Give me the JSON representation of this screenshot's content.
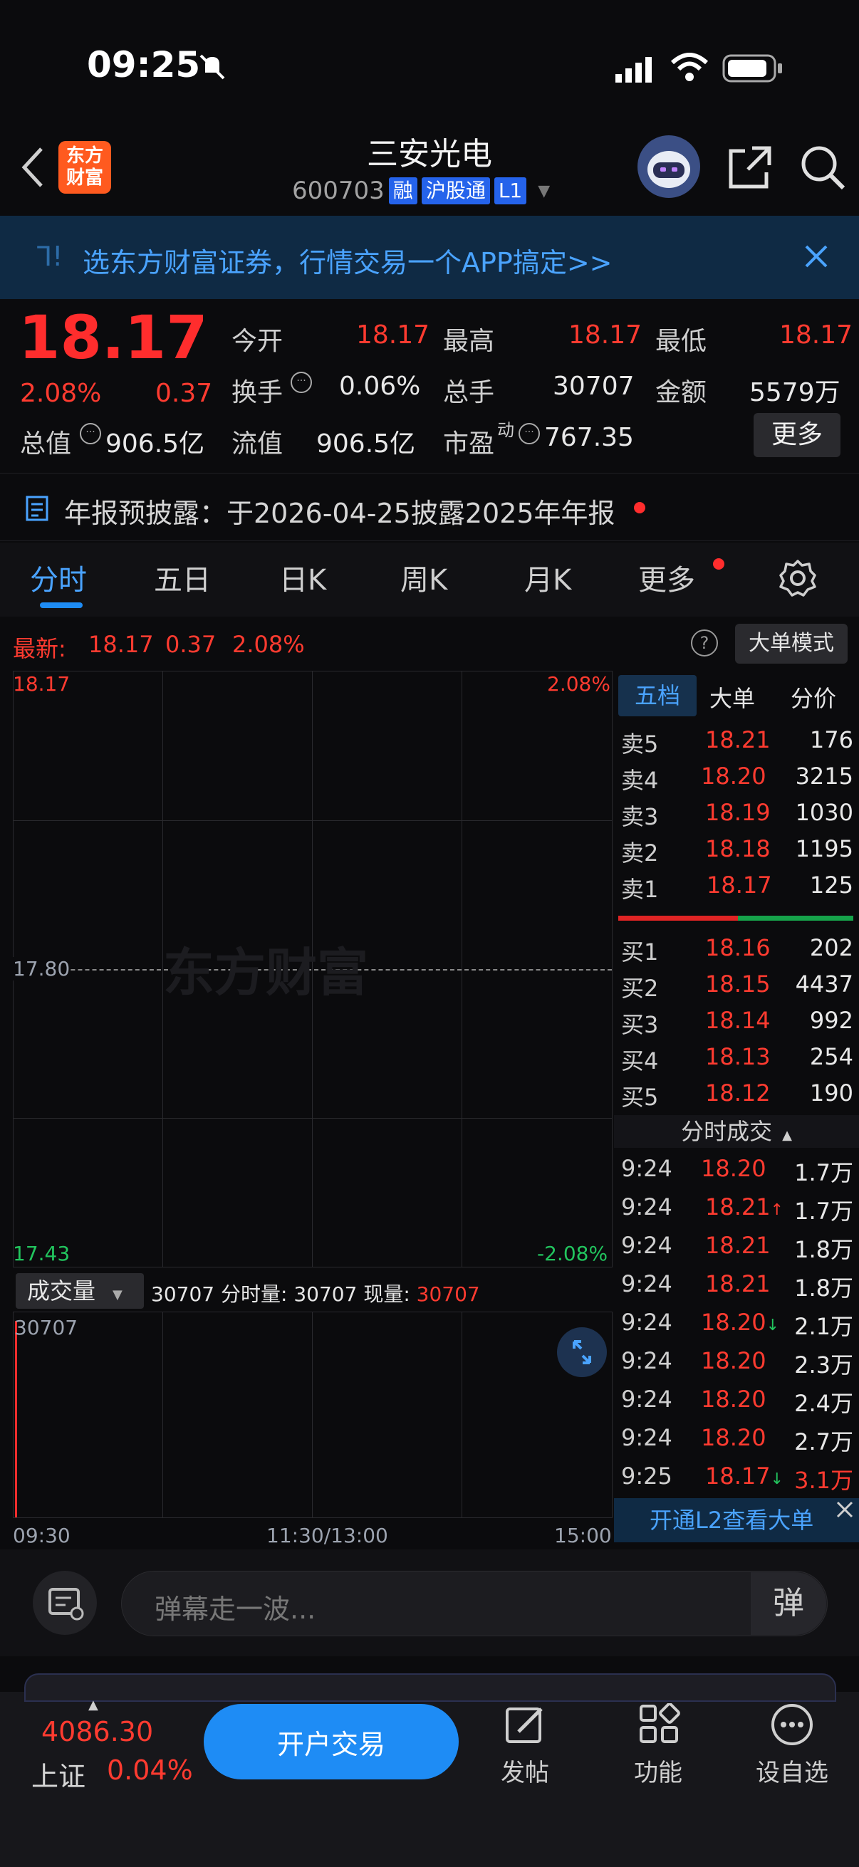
{
  "status_bar": {
    "time": "09:25"
  },
  "header": {
    "title": "三安光电",
    "code": "600703",
    "tag_rong": "融",
    "tag_hgt": "沪股通",
    "tag_l1": "L1",
    "logo_text_1": "东方",
    "logo_text_2": "财富"
  },
  "banner": {
    "text": "选东方财富证券，行情交易一个APP搞定>>"
  },
  "quote": {
    "price": "18.17",
    "change_pct": "2.08%",
    "change": "0.37",
    "open_label": "今开",
    "open": "18.17",
    "high_label": "最高",
    "high": "18.17",
    "low_label": "最低",
    "low": "18.17",
    "turnover_label": "换手",
    "turnover": "0.06%",
    "volume_label": "总手",
    "volume": "30707",
    "amount_label": "金额",
    "amount": "5579万",
    "mktcap_label": "总值",
    "mktcap": "906.5亿",
    "float_label": "流值",
    "float_cap": "906.5亿",
    "pe_label": "市盈",
    "pe_sup": "动",
    "pe": "767.35",
    "more_button": "更多"
  },
  "notice": {
    "text": "年报预披露：于2026-04-25披露2025年年报"
  },
  "tabs": [
    "分时",
    "五日",
    "日K",
    "周K",
    "月K",
    "更多"
  ],
  "latest": {
    "label": "最新:",
    "price": "18.17",
    "change": "0.37",
    "pct": "2.08%",
    "mode_button": "大单模式"
  },
  "chart": {
    "top_price": "18.17",
    "top_pct": "2.08%",
    "mid_price": "17.80",
    "bottom_price": "17.43",
    "bottom_pct": "-2.08%",
    "watermark": "东方财富",
    "volume_dropdown": "成交量",
    "volume_info_total": "30707",
    "volume_info_fen_label": "分时量:",
    "volume_info_fen": "30707",
    "volume_info_now_label": "现量:",
    "volume_info_now": "30707",
    "volume_axis_max": "30707",
    "time_start": "09:30",
    "time_mid": "11:30/13:00",
    "time_end": "15:00"
  },
  "orderbook": {
    "tabs": [
      "五档",
      "大单",
      "分价"
    ],
    "sell": [
      {
        "label": "卖5",
        "price": "18.21",
        "vol": "176"
      },
      {
        "label": "卖4",
        "price": "18.20",
        "vol": "3215"
      },
      {
        "label": "卖3",
        "price": "18.19",
        "vol": "1030"
      },
      {
        "label": "卖2",
        "price": "18.18",
        "vol": "1195"
      },
      {
        "label": "卖1",
        "price": "18.17",
        "vol": "125"
      }
    ],
    "buy": [
      {
        "label": "买1",
        "price": "18.16",
        "vol": "202"
      },
      {
        "label": "买2",
        "price": "18.15",
        "vol": "4437"
      },
      {
        "label": "买3",
        "price": "18.14",
        "vol": "992"
      },
      {
        "label": "买4",
        "price": "18.13",
        "vol": "254"
      },
      {
        "label": "买5",
        "price": "18.12",
        "vol": "190"
      }
    ],
    "ticks_title": "分时成交",
    "ticks": [
      {
        "time": "9:24",
        "price": "18.20",
        "arrow": "",
        "vol": "1.7万"
      },
      {
        "time": "9:24",
        "price": "18.21",
        "arrow": "↑",
        "vol": "1.7万"
      },
      {
        "time": "9:24",
        "price": "18.21",
        "arrow": "",
        "vol": "1.8万"
      },
      {
        "time": "9:24",
        "price": "18.21",
        "arrow": "",
        "vol": "1.8万"
      },
      {
        "time": "9:24",
        "price": "18.20",
        "arrow": "↓",
        "vol": "2.1万"
      },
      {
        "time": "9:24",
        "price": "18.20",
        "arrow": "",
        "vol": "2.3万"
      },
      {
        "time": "9:24",
        "price": "18.20",
        "arrow": "",
        "vol": "2.4万"
      },
      {
        "time": "9:24",
        "price": "18.20",
        "arrow": "",
        "vol": "2.7万"
      },
      {
        "time": "9:25",
        "price": "18.17",
        "arrow": "↓",
        "vol": "3.1万"
      }
    ],
    "l2_button": "开通L2查看大单"
  },
  "comment": {
    "placeholder": "弹幕走一波...",
    "send_label": "弹"
  },
  "bottom_nav": {
    "index_value": "4086.30",
    "index_name": "上证",
    "index_pct": "0.04%",
    "open_account": "开户交易",
    "post": "发帖",
    "func": "功能",
    "watch": "设自选"
  },
  "colors": {
    "up": "#ff3b30",
    "down": "#22c55e",
    "accent": "#1e8cf5"
  }
}
